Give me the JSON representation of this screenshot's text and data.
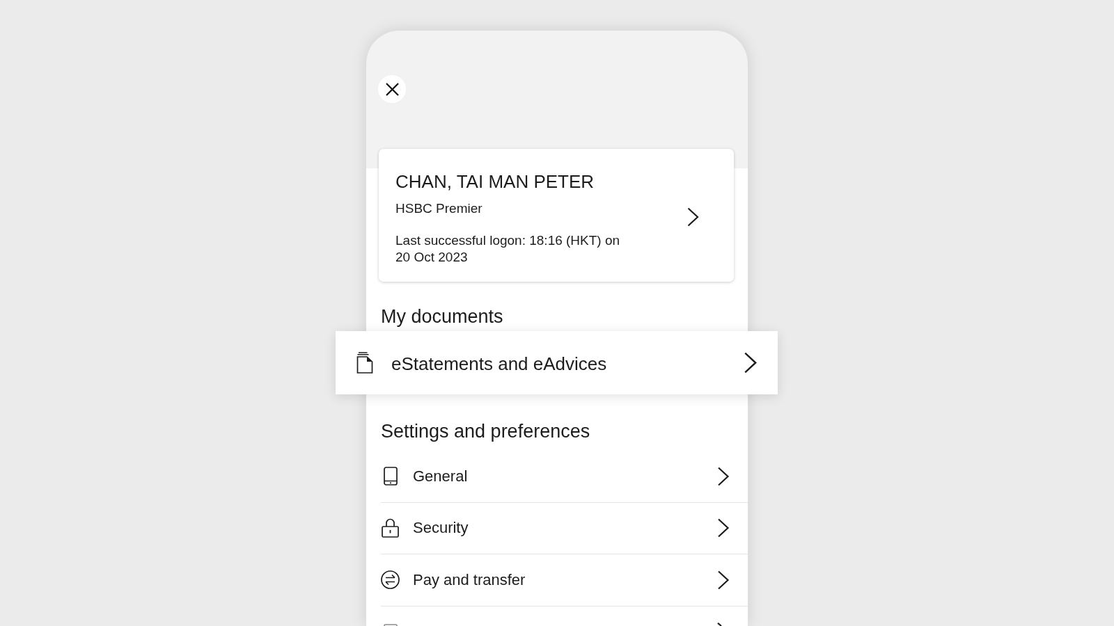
{
  "profile": {
    "name": "CHAN, TAI MAN PETER",
    "tier": "HSBC Premier",
    "last_logon": "Last successful logon: 18:16 (HKT) on 20 Oct 2023"
  },
  "sections": [
    {
      "title": "My documents",
      "kind": "highlight",
      "items": [
        {
          "kind": "link",
          "label": "eStatements and eAdvices"
        }
      ]
    },
    {
      "title": "Settings and preferences",
      "kind": "list",
      "items": [
        {
          "kind": "link",
          "label": "General"
        },
        {
          "kind": "link",
          "label": "Security"
        },
        {
          "kind": "link",
          "label": "Pay and transfer"
        },
        {
          "kind": "cut"
        }
      ]
    }
  ]
}
